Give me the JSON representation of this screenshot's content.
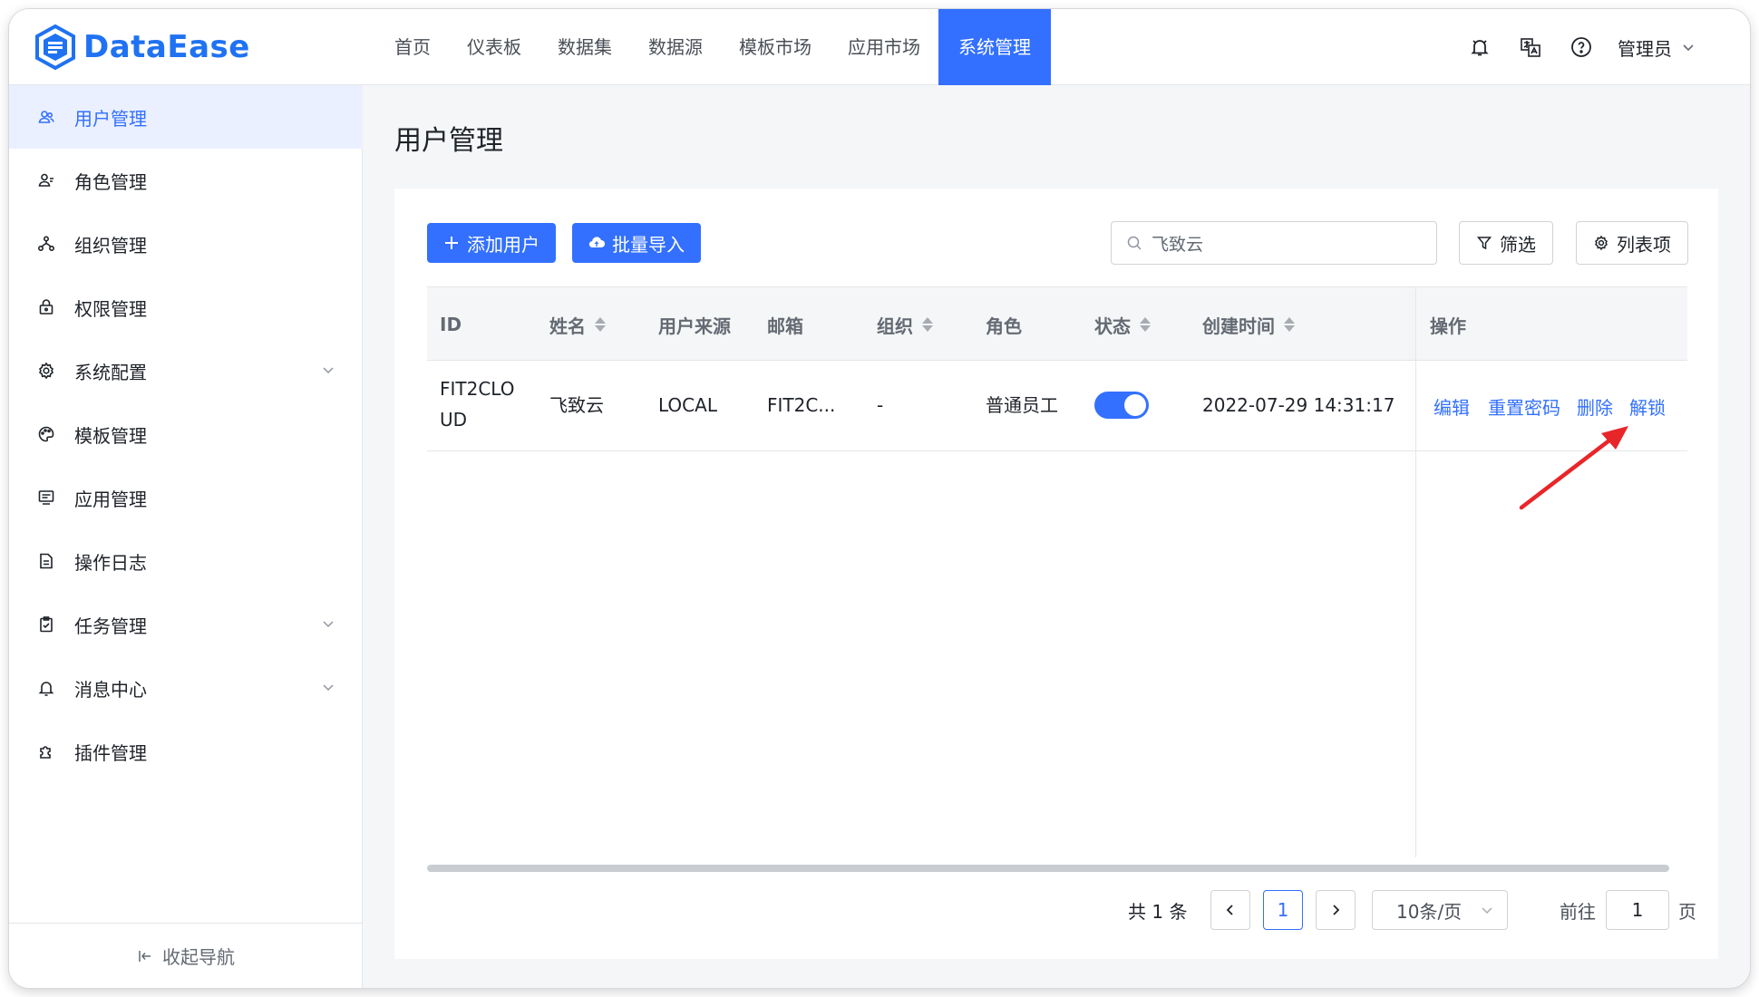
{
  "app": {
    "brand": "DataEase",
    "brand_color": "#1f72f2",
    "accent": "#3370ff"
  },
  "topnav": {
    "items": [
      "首页",
      "仪表板",
      "数据集",
      "数据源",
      "模板市场",
      "应用市场",
      "系统管理"
    ],
    "active": "系统管理",
    "icons": [
      "bell-icon",
      "translate-icon",
      "help-icon"
    ],
    "user": "管理员"
  },
  "sidebar": {
    "items": [
      {
        "label": "用户管理",
        "icon": "users-icon",
        "active": true,
        "expandable": false
      },
      {
        "label": "角色管理",
        "icon": "role-icon",
        "active": false,
        "expandable": false
      },
      {
        "label": "组织管理",
        "icon": "org-icon",
        "active": false,
        "expandable": false
      },
      {
        "label": "权限管理",
        "icon": "lock-icon",
        "active": false,
        "expandable": false
      },
      {
        "label": "系统配置",
        "icon": "gear-icon",
        "active": false,
        "expandable": true
      },
      {
        "label": "模板管理",
        "icon": "palette-icon",
        "active": false,
        "expandable": false
      },
      {
        "label": "应用管理",
        "icon": "app-icon",
        "active": false,
        "expandable": false
      },
      {
        "label": "操作日志",
        "icon": "log-icon",
        "active": false,
        "expandable": false
      },
      {
        "label": "任务管理",
        "icon": "task-icon",
        "active": false,
        "expandable": true
      },
      {
        "label": "消息中心",
        "icon": "bell-icon",
        "active": false,
        "expandable": true
      },
      {
        "label": "插件管理",
        "icon": "plugin-icon",
        "active": false,
        "expandable": false
      }
    ],
    "collapse_label": "收起导航"
  },
  "page": {
    "title": "用户管理"
  },
  "toolbar": {
    "add_user": "添加用户",
    "batch_import": "批量导入",
    "search_value": "飞致云",
    "filter": "筛选",
    "columns": "列表项"
  },
  "table": {
    "headers": [
      "ID",
      "姓名",
      "用户来源",
      "邮箱",
      "组织",
      "角色",
      "状态",
      "创建时间",
      "操作"
    ],
    "sortable": [
      false,
      true,
      false,
      false,
      true,
      false,
      true,
      true,
      false
    ],
    "rows": [
      {
        "id_line1": "FIT2CLO",
        "id_line2": "UD",
        "name": "飞致云",
        "source": "LOCAL",
        "email": "FIT2C...",
        "org": "-",
        "role": "普通员工",
        "status_enabled": true,
        "created": "2022-07-29 14:31:17",
        "actions": [
          "编辑",
          "重置密码",
          "删除",
          "解锁"
        ]
      }
    ]
  },
  "pagination": {
    "total": "共 1 条",
    "current_page": "1",
    "page_size": "10条/页",
    "goto_label": "前往",
    "goto_value": "1",
    "page_suffix": "页"
  },
  "annotation": {
    "arrow_color": "#e8262a",
    "points_to": "解锁"
  }
}
